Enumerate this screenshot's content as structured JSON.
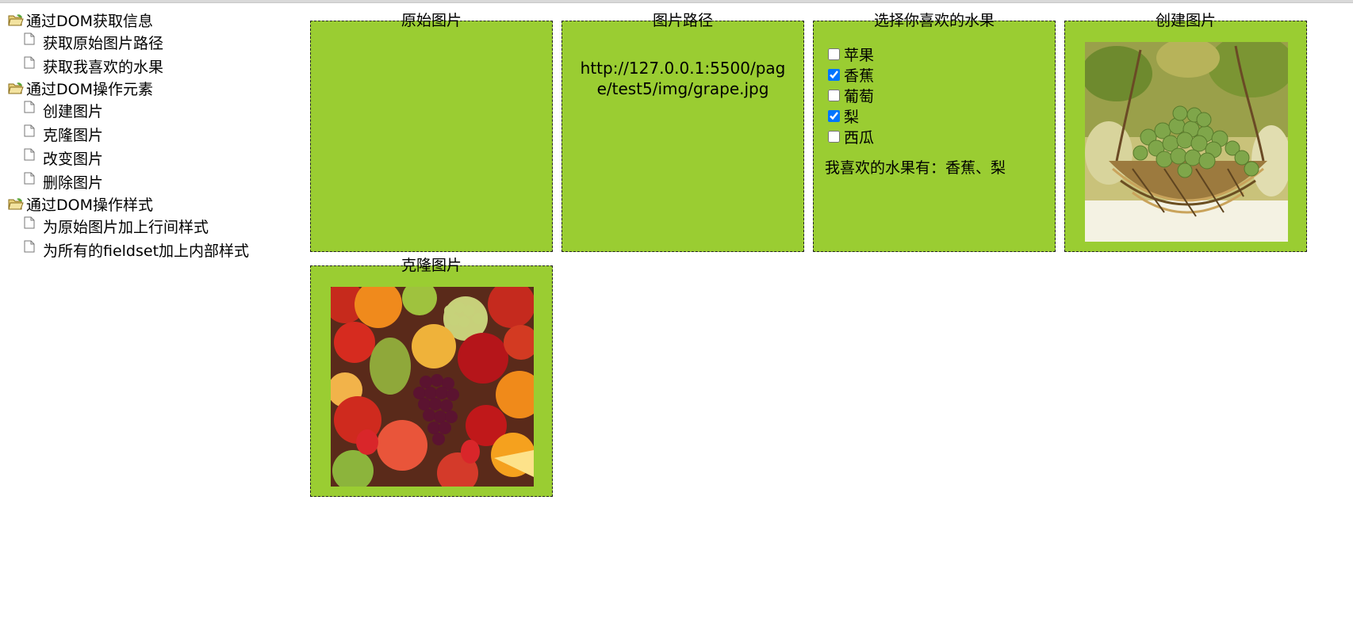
{
  "tree": {
    "groups": [
      {
        "label": "通过DOM获取信息",
        "items": [
          "获取原始图片路径",
          "获取我喜欢的水果"
        ]
      },
      {
        "label": "通过DOM操作元素",
        "items": [
          "创建图片",
          "克隆图片",
          "改变图片",
          "删除图片"
        ]
      },
      {
        "label": "通过DOM操作样式",
        "items": [
          "为原始图片加上行间样式",
          "为所有的fieldset加上内部样式"
        ]
      }
    ]
  },
  "panels": {
    "original": {
      "legend": "原始图片"
    },
    "path": {
      "legend": "图片路径",
      "value": "http://127.0.0.1:5500/page/test5/img/grape.jpg"
    },
    "fruits": {
      "legend": "选择你喜欢的水果",
      "options": [
        {
          "label": "苹果",
          "checked": false
        },
        {
          "label": "香蕉",
          "checked": true
        },
        {
          "label": "葡萄",
          "checked": false
        },
        {
          "label": "梨",
          "checked": true
        },
        {
          "label": "西瓜",
          "checked": false
        }
      ],
      "favorite_prefix": "我喜欢的水果有：",
      "favorite_value": "香蕉、梨"
    },
    "created": {
      "legend": "创建图片"
    },
    "cloned": {
      "legend": "克隆图片"
    }
  },
  "colors": {
    "panel_bg": "#9acd32",
    "checkbox_accent": "#0075ff"
  },
  "icons": {
    "folder": "open-folder-icon",
    "page": "document-icon"
  }
}
